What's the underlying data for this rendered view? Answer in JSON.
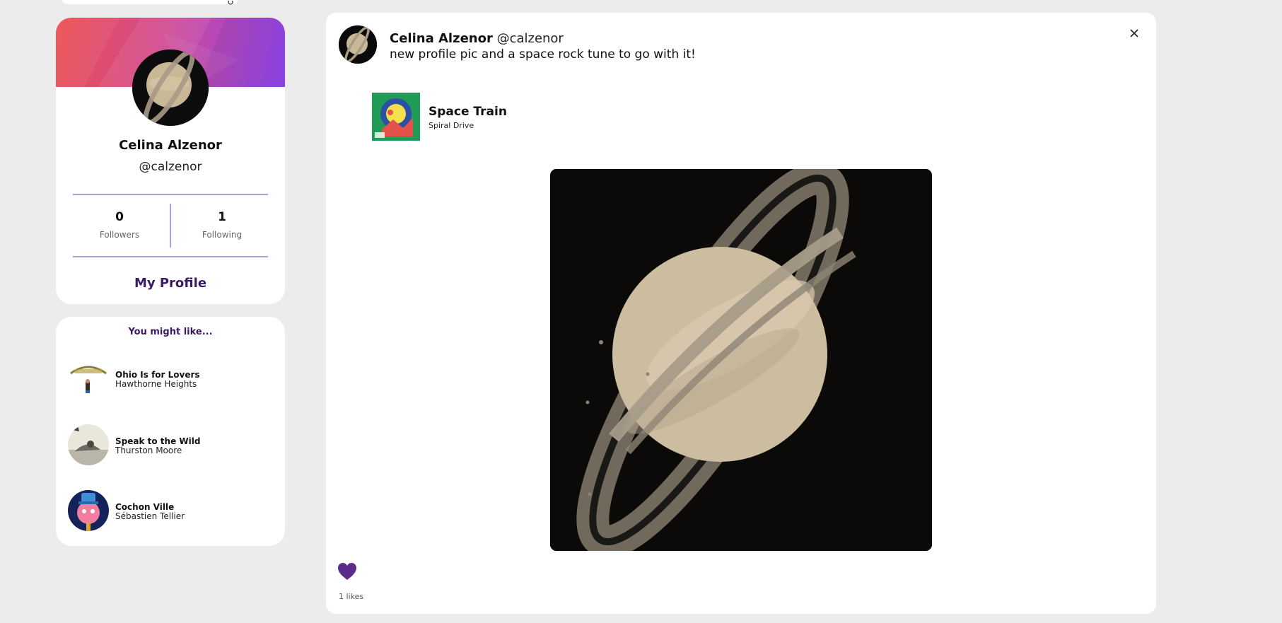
{
  "profile": {
    "name": "Celina Alzenor",
    "handle": "@calzenor",
    "followers_count": "0",
    "followers_label": "Followers",
    "following_count": "1",
    "following_label": "Following",
    "my_profile_label": "My Profile"
  },
  "suggestions": {
    "title": "You might like...",
    "items": [
      {
        "title": "Ohio Is for Lovers",
        "artist": "Hawthorne Heights"
      },
      {
        "title": "Speak to the Wild",
        "artist": "Thurston Moore"
      },
      {
        "title": "Cochon Ville",
        "artist": "Sébastien Tellier"
      }
    ]
  },
  "post": {
    "author_name": "Celina Alzenor",
    "author_handle": "@calzenor",
    "text": "new profile pic and a space rock tune to go with it!",
    "track_title": "Space Train",
    "track_artist": "Spiral Drive",
    "likes_label": "1 likes",
    "icons": {
      "close": "close-icon",
      "like": "heart-icon"
    }
  },
  "colors": {
    "background": "#ececec",
    "accent": "#3b1a63",
    "heart": "#5b2d8a",
    "divider": "#b39ed8"
  }
}
